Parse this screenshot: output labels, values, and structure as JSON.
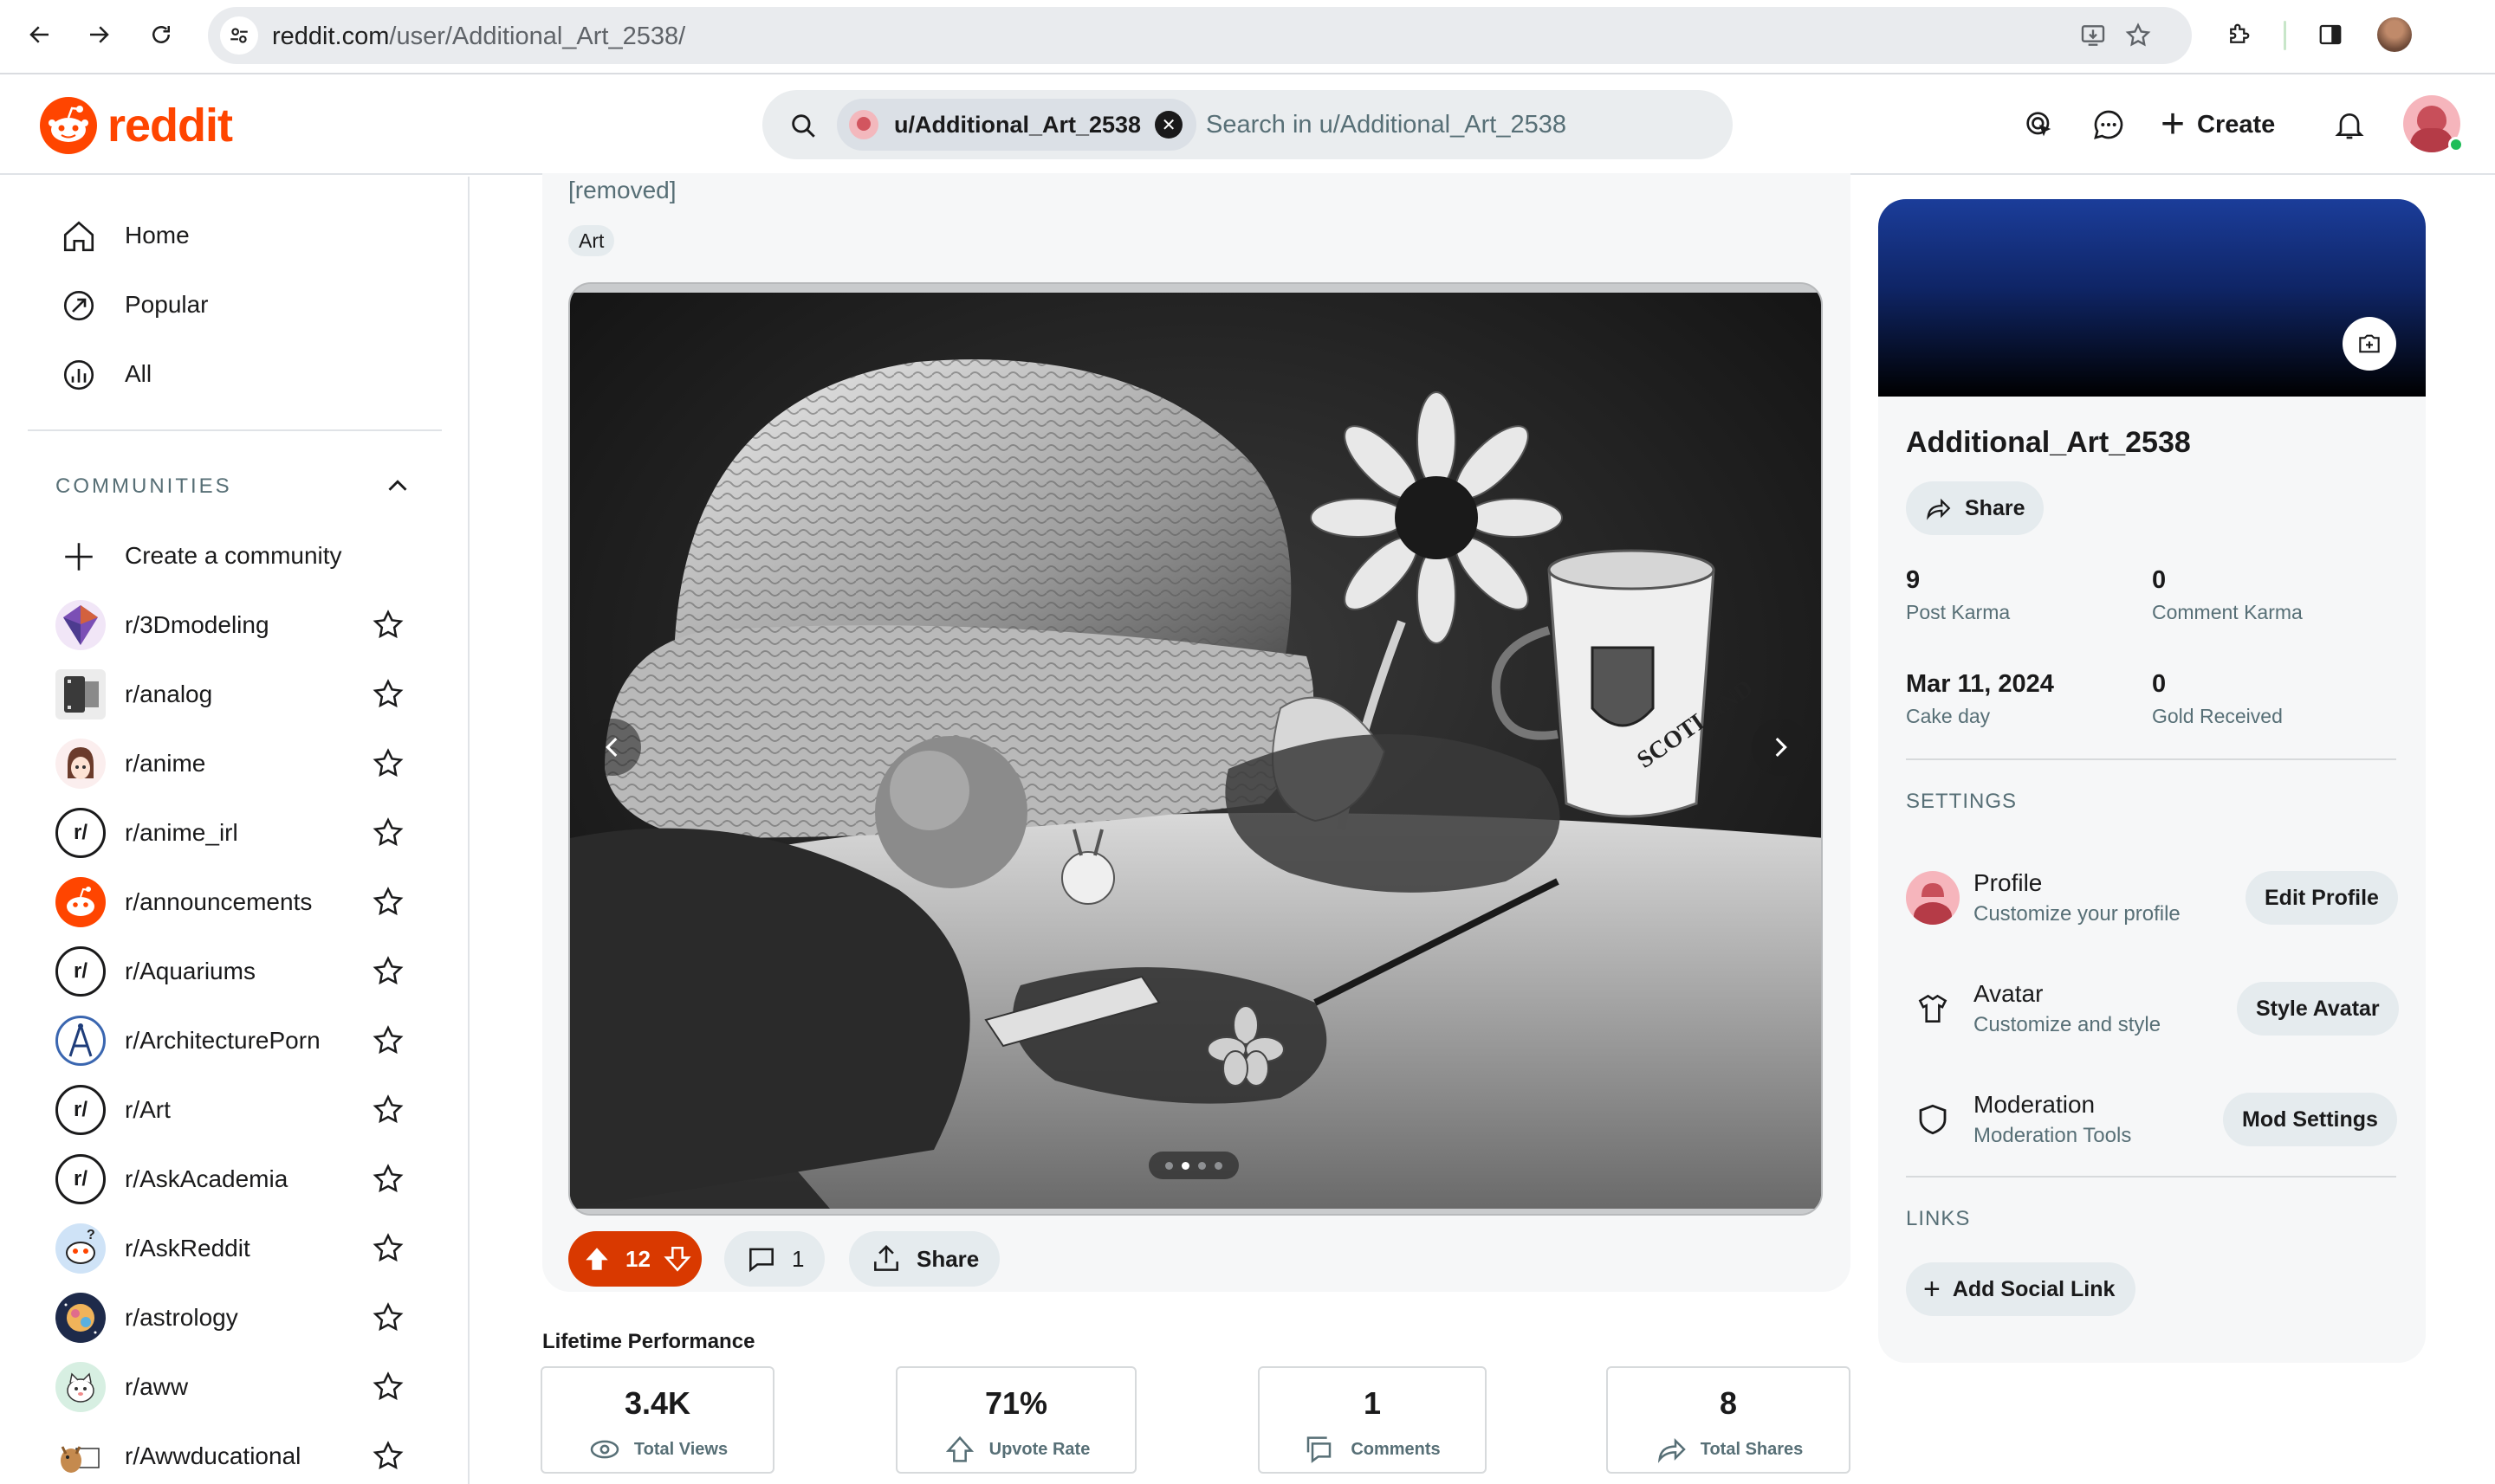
{
  "browser": {
    "url_host": "reddit.com",
    "url_path": "/user/Additional_Art_2538/"
  },
  "header": {
    "logo_text": "reddit",
    "search_chip": "u/Additional_Art_2538",
    "search_placeholder": "Search in u/Additional_Art_2538",
    "create_label": "Create"
  },
  "sidebar": {
    "nav": [
      {
        "label": "Home",
        "icon": "home-icon"
      },
      {
        "label": "Popular",
        "icon": "popular-icon"
      },
      {
        "label": "All",
        "icon": "all-icon"
      }
    ],
    "communities_heading": "COMMUNITIES",
    "create_community": "Create a community",
    "communities": [
      {
        "name": "r/3Dmodeling"
      },
      {
        "name": "r/analog"
      },
      {
        "name": "r/anime"
      },
      {
        "name": "r/anime_irl"
      },
      {
        "name": "r/announcements"
      },
      {
        "name": "r/Aquariums"
      },
      {
        "name": "r/ArchitecturePorn"
      },
      {
        "name": "r/Art"
      },
      {
        "name": "r/AskAcademia"
      },
      {
        "name": "r/AskReddit"
      },
      {
        "name": "r/astrology"
      },
      {
        "name": "r/aww"
      },
      {
        "name": "r/Awwducational"
      }
    ]
  },
  "post": {
    "body": "[removed]",
    "flair": "Art",
    "carousel_total": 4,
    "carousel_index": 2,
    "score": "12",
    "comments": "1",
    "share_label": "Share"
  },
  "performance": {
    "title": "Lifetime Performance",
    "metrics": [
      {
        "value": "3.4K",
        "label": "Total Views",
        "icon": "views-icon"
      },
      {
        "value": "71%",
        "label": "Upvote Rate",
        "icon": "upvote-rate-icon"
      },
      {
        "value": "1",
        "label": "Comments",
        "icon": "comments-icon"
      },
      {
        "value": "8",
        "label": "Total Shares",
        "icon": "shares-icon"
      }
    ]
  },
  "profile": {
    "username": "Additional_Art_2538",
    "share_label": "Share",
    "stats": [
      {
        "value": "9",
        "label": "Post Karma"
      },
      {
        "value": "0",
        "label": "Comment Karma"
      },
      {
        "value": "Mar 11, 2024",
        "label": "Cake day"
      },
      {
        "value": "0",
        "label": "Gold Received"
      }
    ],
    "settings_heading": "SETTINGS",
    "settings": [
      {
        "title": "Profile",
        "subtitle": "Customize your profile",
        "button": "Edit Profile"
      },
      {
        "title": "Avatar",
        "subtitle": "Customize and style",
        "button": "Style Avatar"
      },
      {
        "title": "Moderation",
        "subtitle": "Moderation Tools",
        "button": "Mod Settings"
      }
    ],
    "links_heading": "LINKS",
    "add_social_link": "Add Social Link"
  },
  "colors": {
    "brand": "#ff4500",
    "upvoted": "#d93900",
    "secondary_text": "#576f76",
    "button_bg": "#e5ebee"
  }
}
